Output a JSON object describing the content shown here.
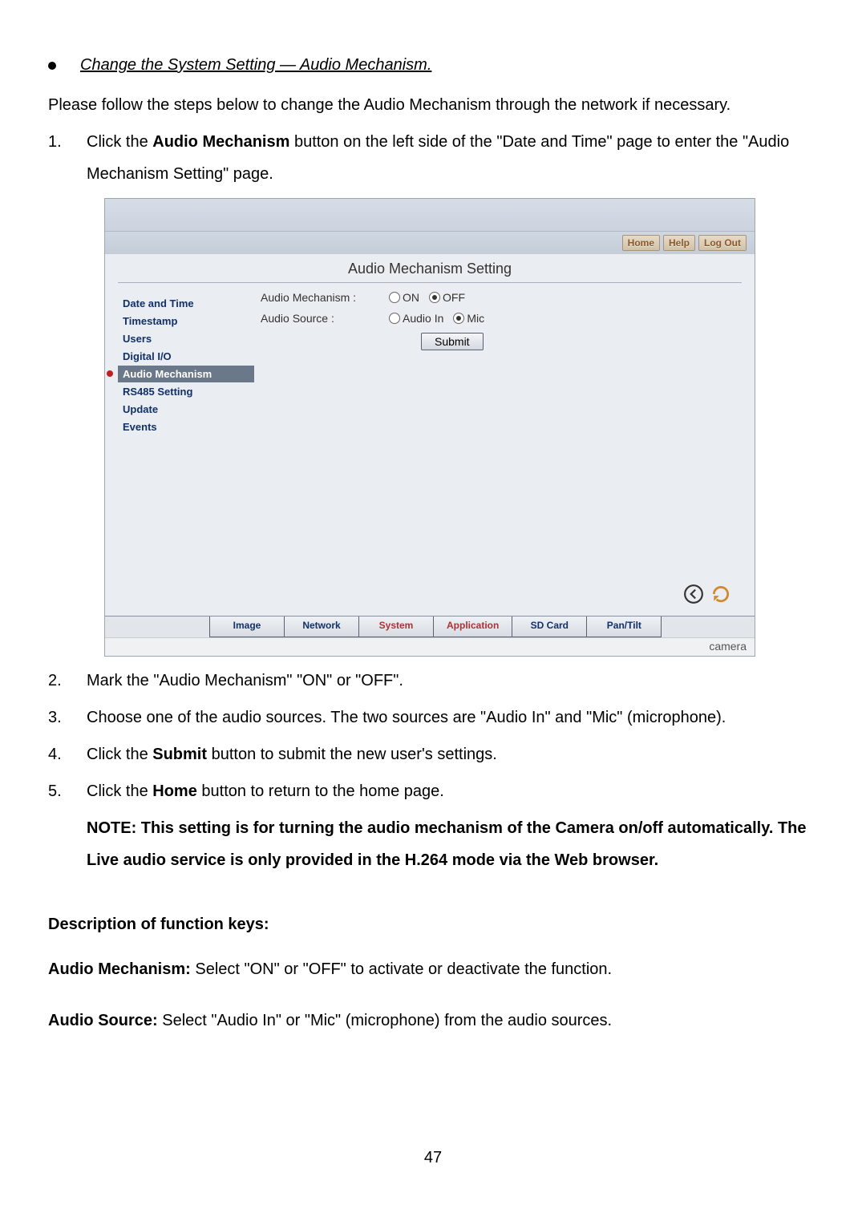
{
  "bullet_title": "Change the System Setting — Audio Mechanism.",
  "intro": "Please follow the steps below to change the Audio Mechanism through the network if necessary.",
  "steps": {
    "s1_pre": "Click the ",
    "s1_bold": "Audio Mechanism",
    "s1_post": " button on the left side of the \"Date and Time\" page to enter the \"Audio Mechanism Setting\" page.",
    "s2": "Mark the \"Audio Mechanism\" \"ON\" or \"OFF\".",
    "s3": "Choose one of the audio sources. The two sources are \"Audio In\" and \"Mic\" (microphone).",
    "s4_pre": "Click the ",
    "s4_bold": "Submit",
    "s4_post": " button to submit the new user's settings.",
    "s5_pre": "Click the ",
    "s5_bold": "Home",
    "s5_post": " button to return to the home page."
  },
  "note_label": "NOTE",
  "note_body": ": This setting is for turning the audio mechanism of the Camera on/off automatically. The Live audio service is only provided in the H.264 mode via the Web browser.",
  "desc_heading": "Description of function keys:",
  "desc_am_label": "Audio Mechanism:",
  "desc_am_body": " Select \"ON\" or \"OFF\" to activate or deactivate the function.",
  "desc_as_label": "Audio Source:",
  "desc_as_body": " Select \"Audio In\" or \"Mic\" (microphone) from the audio sources.",
  "page_number": "47",
  "shot": {
    "toplinks": {
      "home": "Home",
      "help": "Help",
      "logout": "Log Out"
    },
    "section_title": "Audio Mechanism Setting",
    "sidebar": [
      "Date and Time",
      "Timestamp",
      "Users",
      "Digital I/O",
      "Audio Mechanism",
      "RS485 Setting",
      "Update",
      "Events"
    ],
    "form": {
      "mech_label": "Audio Mechanism :",
      "mech_on": "ON",
      "mech_off": "OFF",
      "src_label": "Audio Source :",
      "src_in": "Audio In",
      "src_mic": "Mic",
      "submit": "Submit"
    },
    "tabs": {
      "image": "Image",
      "network": "Network",
      "system": "System",
      "application": "Application",
      "sdcard": "SD Card",
      "pantilt": "Pan/Tilt"
    },
    "camera": "camera"
  }
}
